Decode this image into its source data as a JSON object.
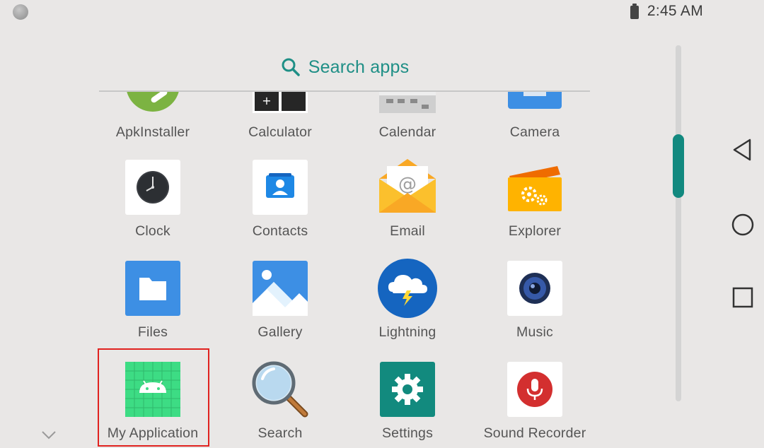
{
  "status_bar": {
    "time": "2:45 AM",
    "battery_icon": "battery-charging-icon"
  },
  "search": {
    "label": "Search apps",
    "icon": "search-icon"
  },
  "apps": {
    "apkinstaller": {
      "label": "ApkInstaller",
      "icon": "apkinstaller-icon"
    },
    "calculator": {
      "label": "Calculator",
      "icon": "calculator-icon"
    },
    "calendar": {
      "label": "Calendar",
      "icon": "calendar-icon"
    },
    "camera": {
      "label": "Camera",
      "icon": "camera-icon"
    },
    "clock": {
      "label": "Clock",
      "icon": "clock-icon"
    },
    "contacts": {
      "label": "Contacts",
      "icon": "contacts-icon"
    },
    "email": {
      "label": "Email",
      "icon": "email-icon"
    },
    "explorer": {
      "label": "Explorer",
      "icon": "explorer-icon"
    },
    "files": {
      "label": "Files",
      "icon": "files-icon"
    },
    "gallery": {
      "label": "Gallery",
      "icon": "gallery-icon"
    },
    "lightning": {
      "label": "Lightning",
      "icon": "lightning-icon"
    },
    "music": {
      "label": "Music",
      "icon": "music-icon"
    },
    "my_application": {
      "label": "My Application",
      "icon": "android-icon",
      "highlighted": true
    },
    "search": {
      "label": "Search",
      "icon": "magnifier-icon"
    },
    "settings": {
      "label": "Settings",
      "icon": "settings-icon"
    },
    "sound_recorder": {
      "label": "Sound Recorder",
      "icon": "microphone-icon"
    }
  },
  "nav_bar": {
    "back": "back-icon",
    "home": "home-icon",
    "recents": "recents-icon"
  },
  "colors": {
    "accent": "#12897f",
    "highlight": "#e0221f",
    "background": "#e9e7e6"
  }
}
